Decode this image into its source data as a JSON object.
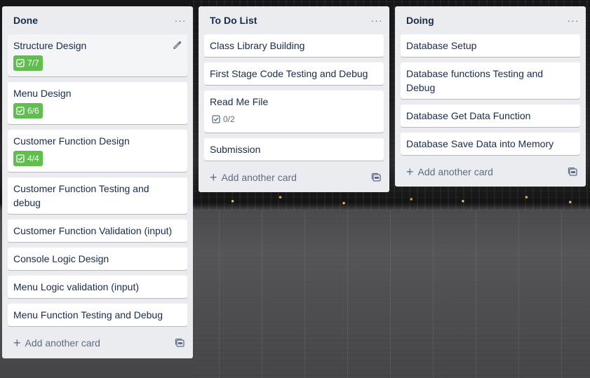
{
  "lists": [
    {
      "title": "Done",
      "menu": "···",
      "cards": [
        {
          "title": "Structure Design",
          "badge": "7/7"
        },
        {
          "title": "Menu Design",
          "badge": "6/6"
        },
        {
          "title": "Customer Function Design",
          "badge": "4/4"
        },
        {
          "title": "Customer Function Testing and debug"
        },
        {
          "title": "Customer Function Validation (input)"
        },
        {
          "title": "Console Logic Design"
        },
        {
          "title": "Menu Logic validation (input)"
        },
        {
          "title": "Menu Function Testing and Debug"
        }
      ],
      "add_label": "Add another card"
    },
    {
      "title": "To Do List",
      "menu": "···",
      "cards": [
        {
          "title": "Class Library Building"
        },
        {
          "title": "First Stage Code Testing and Debug"
        },
        {
          "title": "Read Me File",
          "badge": "0/2"
        },
        {
          "title": "Submission"
        }
      ],
      "add_label": "Add another card"
    },
    {
      "title": "Doing",
      "menu": "···",
      "cards": [
        {
          "title": "Database Setup"
        },
        {
          "title": "Database functions Testing and Debug"
        },
        {
          "title": "Database Get Data Function"
        },
        {
          "title": "Database Save Data into Memory"
        }
      ],
      "add_label": "Add another card"
    }
  ],
  "colors": {
    "list_bg": "#ebecf0",
    "card_bg": "#ffffff",
    "badge_complete": "#61bd4f",
    "text": "#172b4d",
    "muted": "#5e6c84"
  },
  "icons": {
    "edit": "pencil-icon",
    "checklist": "checkbox-icon",
    "add": "plus-icon",
    "template": "card-template-icon",
    "menu": "ellipsis-icon"
  }
}
